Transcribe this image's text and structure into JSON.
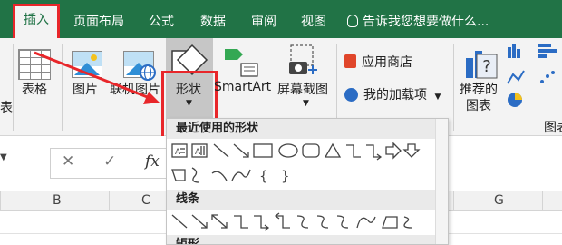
{
  "tabs": [
    {
      "label": "插入",
      "active": true
    },
    {
      "label": "页面布局"
    },
    {
      "label": "公式"
    },
    {
      "label": "数据"
    },
    {
      "label": "审阅"
    },
    {
      "label": "视图"
    }
  ],
  "tell_me": "告诉我您想要做什么...",
  "ribbon": {
    "left_cut_label": "表",
    "table_label": "表格",
    "picture_label": "图片",
    "online_picture_label": "联机图片",
    "shapes_label": "形状",
    "smartart_label": "SmartArt",
    "screenshot_label": "屏幕截图",
    "store_label": "应用商店",
    "my_addins_label": "我的加载项",
    "recommended_charts_line1": "推荐的",
    "recommended_charts_line2": "图表",
    "charts_group_cut": "图表"
  },
  "formula_bar": {
    "cancel_symbol": "✕",
    "enter_symbol": "✓",
    "fx_symbol": "fx"
  },
  "columns": [
    "B",
    "C",
    "G"
  ],
  "shapes_menu": {
    "recent_header": "最近使用的形状",
    "lines_header": "线条",
    "rect_header": "矩形"
  },
  "colors": {
    "excel_green": "#217346",
    "highlight_red": "#e8262a"
  }
}
